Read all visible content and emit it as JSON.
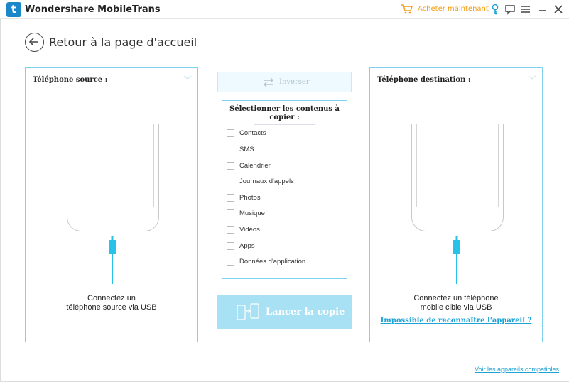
{
  "titlebar": {
    "logo_letter": "t",
    "title": "Wondershare MobileTrans",
    "buy_label": "Acheter maintenant",
    "icons": [
      "cart-icon",
      "key-icon",
      "feedback-icon",
      "menu-icon",
      "minimize-icon",
      "close-icon"
    ]
  },
  "back": {
    "label": "Retour à la page d'accueil",
    "icon": "back-arrow-icon"
  },
  "source_panel": {
    "title": "Téléphone source :",
    "instruction_line1": "Connectez un",
    "instruction_line2": "téléphone source via USB"
  },
  "destination_panel": {
    "title": "Téléphone destination :",
    "instruction_line1": "Connectez un téléphone",
    "instruction_line2": "mobile cible via USB",
    "help_link": "Impossible de reconnaître l'appareil ?"
  },
  "swap_button": {
    "label": "Inverser"
  },
  "content_select": {
    "header_line1": "Sélectionner les contenus à",
    "header_line2": "copier :",
    "items": [
      {
        "label": "Contacts",
        "checked": false
      },
      {
        "label": "SMS",
        "checked": false
      },
      {
        "label": "Calendrier",
        "checked": false
      },
      {
        "label": "Journaux d'appels",
        "checked": false
      },
      {
        "label": "Photos",
        "checked": false
      },
      {
        "label": "Musique",
        "checked": false
      },
      {
        "label": "Vidéos",
        "checked": false
      },
      {
        "label": "Apps",
        "checked": false
      },
      {
        "label": "Données d'application",
        "checked": false
      }
    ]
  },
  "start_button": {
    "label": "Lancer la copie"
  },
  "footer": {
    "compat_link": "Voir les appareils compatibles"
  },
  "colors": {
    "accent": "#7fd3ee",
    "link": "#1ea3d6",
    "buy": "#f39c12",
    "start_button": "#a9e1f4",
    "cable": "#28c2e9"
  }
}
